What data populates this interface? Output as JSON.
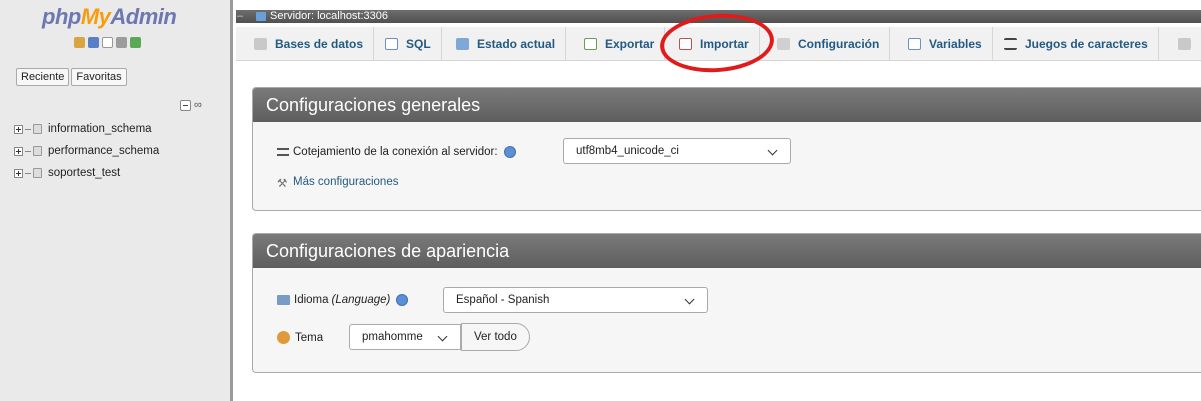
{
  "sidebar": {
    "logo": {
      "php": "php",
      "my": "My",
      "admin": "Admin"
    },
    "tabs": [
      "Reciente",
      "Favoritas"
    ],
    "databases": [
      "information_schema",
      "performance_schema",
      "soportest_test"
    ]
  },
  "serverbar": {
    "label": "Servidor: localhost:3306"
  },
  "menu": [
    "Bases de datos",
    "SQL",
    "Estado actual",
    "Exportar",
    "Importar",
    "Configuración",
    "Variables",
    "Juegos de caracteres"
  ],
  "general": {
    "title": "Configuraciones generales",
    "collation_label": "Cotejamiento de la conexión al servidor:",
    "collation_value": "utf8mb4_unicode_ci",
    "more": "Más configuraciones"
  },
  "appearance": {
    "title": "Configuraciones de apariencia",
    "language_label": "Idioma",
    "language_paren": "(Language)",
    "language_value": "Español - Spanish",
    "theme_label": "Tema",
    "theme_value": "pmahomme",
    "view_all": "Ver todo"
  },
  "colors": {
    "accent": "#235a81",
    "annotation": "#e01b1b"
  }
}
